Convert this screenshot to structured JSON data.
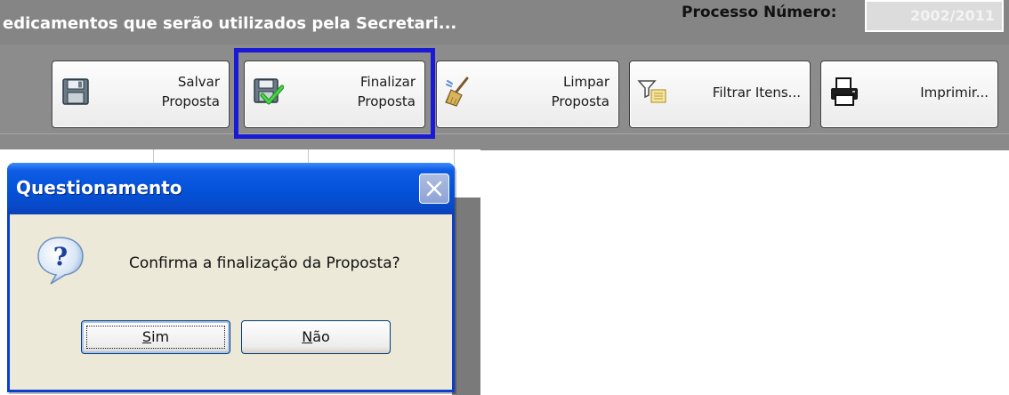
{
  "header": {
    "page_title": "edicamentos que serão utilizados pela Secretari...",
    "process_label": "Processo Número:",
    "process_value": "2002/2011"
  },
  "toolbar": {
    "buttons": [
      {
        "id": "salvar",
        "label": "Salvar\nProposta",
        "icon": "floppy-disk-icon"
      },
      {
        "id": "finalizar",
        "label": "Finalizar\nProposta",
        "icon": "floppy-check-icon",
        "highlighted": true
      },
      {
        "id": "limpar",
        "label": "Limpar\nProposta",
        "icon": "broom-icon"
      },
      {
        "id": "filtrar",
        "label": "Filtrar Itens...",
        "icon": "filter-icon"
      },
      {
        "id": "imprimir",
        "label": "Imprimir...",
        "icon": "printer-icon"
      }
    ]
  },
  "dialog": {
    "title": "Questionamento",
    "message": "Confirma a finalização da Proposta?",
    "icon": "question-icon",
    "buttons": {
      "yes": {
        "mnemonic": "S",
        "rest": "im"
      },
      "no": {
        "mnemonic": "N",
        "rest": "ão"
      }
    }
  },
  "colors": {
    "highlight_frame": "#1a1ad6",
    "dialog_titlebar": "#0352d8",
    "dialog_body": "#ece9d8",
    "app_background": "#858585"
  }
}
